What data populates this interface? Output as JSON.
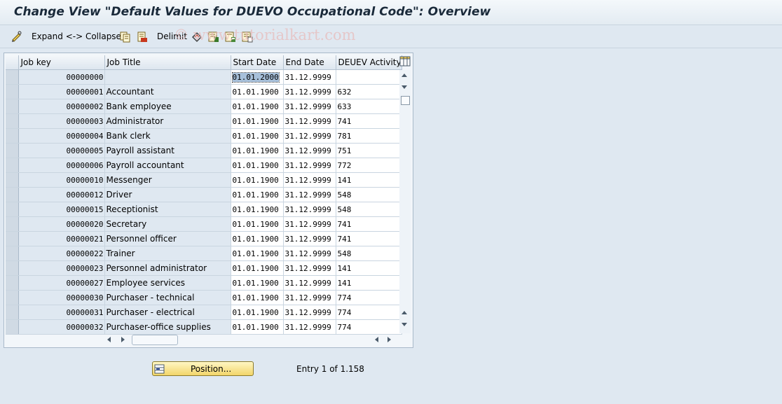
{
  "window": {
    "title": "Change View \"Default Values for DUEVO Occupational Code\": Overview"
  },
  "toolbar": {
    "expand_collapse_label": "Expand <-> Collapse",
    "delimit_label": "Delimit",
    "watermark": "© www.tutorialkart.com"
  },
  "table": {
    "columns": [
      "Job key",
      "Job Title",
      "Start Date",
      "End Date",
      "DEUEV Activity"
    ],
    "rows": [
      {
        "key": "00000000",
        "title": "",
        "start": "01.01.2000",
        "end": "31.12.9999",
        "activity": ""
      },
      {
        "key": "00000001",
        "title": "Accountant",
        "start": "01.01.1900",
        "end": "31.12.9999",
        "activity": "632"
      },
      {
        "key": "00000002",
        "title": "Bank employee",
        "start": "01.01.1900",
        "end": "31.12.9999",
        "activity": "633"
      },
      {
        "key": "00000003",
        "title": "Administrator",
        "start": "01.01.1900",
        "end": "31.12.9999",
        "activity": "741"
      },
      {
        "key": "00000004",
        "title": "Bank clerk",
        "start": "01.01.1900",
        "end": "31.12.9999",
        "activity": "781"
      },
      {
        "key": "00000005",
        "title": "Payroll assistant",
        "start": "01.01.1900",
        "end": "31.12.9999",
        "activity": "751"
      },
      {
        "key": "00000006",
        "title": "Payroll accountant",
        "start": "01.01.1900",
        "end": "31.12.9999",
        "activity": "772"
      },
      {
        "key": "00000010",
        "title": "Messenger",
        "start": "01.01.1900",
        "end": "31.12.9999",
        "activity": "141"
      },
      {
        "key": "00000012",
        "title": "Driver",
        "start": "01.01.1900",
        "end": "31.12.9999",
        "activity": "548"
      },
      {
        "key": "00000015",
        "title": "Receptionist",
        "start": "01.01.1900",
        "end": "31.12.9999",
        "activity": "548"
      },
      {
        "key": "00000020",
        "title": "Secretary",
        "start": "01.01.1900",
        "end": "31.12.9999",
        "activity": "741"
      },
      {
        "key": "00000021",
        "title": "Personnel officer",
        "start": "01.01.1900",
        "end": "31.12.9999",
        "activity": "741"
      },
      {
        "key": "00000022",
        "title": "Trainer",
        "start": "01.01.1900",
        "end": "31.12.9999",
        "activity": "548"
      },
      {
        "key": "00000023",
        "title": "Personnel administrator",
        "start": "01.01.1900",
        "end": "31.12.9999",
        "activity": "141"
      },
      {
        "key": "00000027",
        "title": "Employee services",
        "start": "01.01.1900",
        "end": "31.12.9999",
        "activity": "141"
      },
      {
        "key": "00000030",
        "title": "Purchaser - technical",
        "start": "01.01.1900",
        "end": "31.12.9999",
        "activity": "774"
      },
      {
        "key": "00000031",
        "title": "Purchaser - electrical",
        "start": "01.01.1900",
        "end": "31.12.9999",
        "activity": "774"
      },
      {
        "key": "00000032",
        "title": "Purchaser-office supplies",
        "start": "01.01.1900",
        "end": "31.12.9999",
        "activity": "774"
      }
    ]
  },
  "footer": {
    "position_button_label": "Position...",
    "entry_text": "Entry 1 of 1.158"
  }
}
